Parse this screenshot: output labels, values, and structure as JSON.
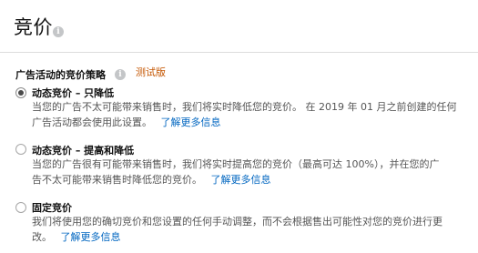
{
  "header": {
    "title": "竞价",
    "info_icon": "info-icon"
  },
  "strategy": {
    "label": "广告活动的竞价策略",
    "beta_badge": "测试版"
  },
  "options": [
    {
      "label": "动态竞价 – 只降低",
      "selected": true,
      "desc_line1": "当您的广告不太可能带来销售时，我们将实时降低您的竞价。 在 2019 年 01 月之前创建的任何",
      "desc_line2": "广告活动都会使用此设置。",
      "link": "了解更多信息"
    },
    {
      "label": "动态竞价 – 提高和降低",
      "selected": false,
      "desc_line1": "当您的广告很有可能带来销售时，我们将实时提高您的竞价（最高可达 100%），并在您的广",
      "desc_line2": "告不太可能带来销售时降低您的竞价。",
      "link": "了解更多信息"
    },
    {
      "label": "固定竞价",
      "selected": false,
      "desc_line1": "我们将使用您的确切竞价和您设置的任何手动调整，而不会根据售出可能性对您的竞价进行更",
      "desc_line2": "改。",
      "link": "了解更多信息"
    }
  ],
  "colors": {
    "link": "#0066c0",
    "beta": "#c45500",
    "desc_text": "#555555"
  }
}
